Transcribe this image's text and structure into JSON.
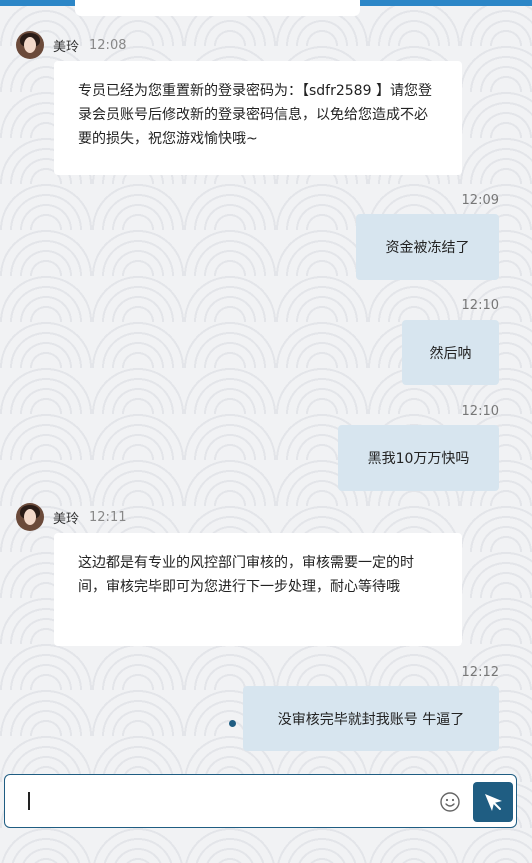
{
  "messages": [
    {
      "sender": "agent",
      "name": "美玲",
      "time": "12:08",
      "text": "专员已经为您重置新的登录密码为：【sdfr2589 】请您登录会员账号后修改新的登录密码信息，以免给您造成不必要的损失，祝您游戏愉快哦~"
    },
    {
      "sender": "user",
      "time": "12:09",
      "text": "资金被冻结了"
    },
    {
      "sender": "user",
      "time": "12:10",
      "text": "然后呐"
    },
    {
      "sender": "user",
      "time": "12:10",
      "text": "黑我10万万快吗"
    },
    {
      "sender": "agent",
      "name": "美玲",
      "time": "12:11",
      "text": "这边都是有专业的风控部门审核的，审核需要一定的时间，审核完毕即可为您进行下一步处理，耐心等待哦"
    },
    {
      "sender": "user",
      "time": "12:12",
      "text": "没审核完毕就封我账号 牛逼了"
    }
  ],
  "composer": {
    "value": "",
    "emoji_icon": "smiley-icon",
    "send_icon": "paper-plane-icon"
  },
  "colors": {
    "accent": "#1f5d82",
    "top_bar": "#2c86c7",
    "user_bubble": "#d7e5ef",
    "agent_bubble": "#ffffff"
  }
}
